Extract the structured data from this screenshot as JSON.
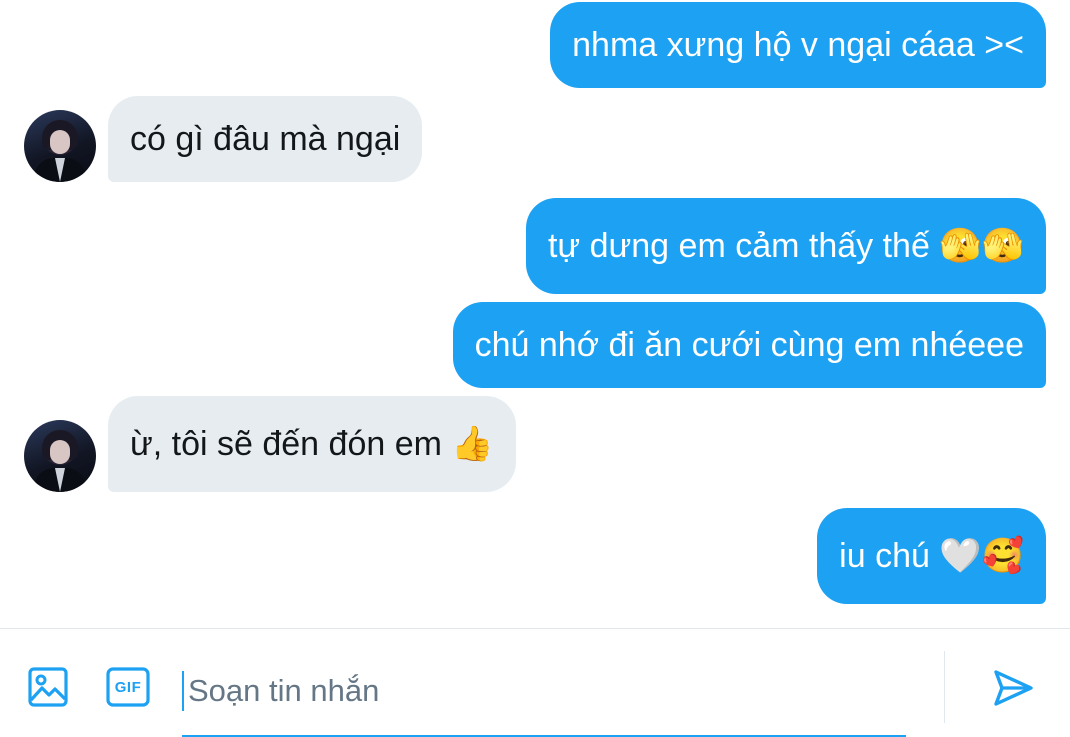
{
  "conversation": {
    "messages": [
      {
        "direction": "outgoing",
        "text": "nhma xưng hộ v ngại cáaa ><"
      },
      {
        "direction": "incoming",
        "text": "có gì đâu mà ngại"
      },
      {
        "direction": "outgoing",
        "text": "tự dưng em cảm thấy thế 🫣🫣"
      },
      {
        "direction": "outgoing",
        "text": "chú nhớ đi ăn cưới cùng em nhéeee"
      },
      {
        "direction": "incoming",
        "text": "ừ, tôi sẽ đến đón em 👍"
      },
      {
        "direction": "outgoing",
        "text": "iu chú 🤍🥰"
      }
    ]
  },
  "composer": {
    "placeholder": "Soạn tin nhắn",
    "value": "",
    "gif_label": "GIF",
    "icons": [
      "image-icon",
      "gif-icon",
      "send-icon"
    ]
  },
  "colors": {
    "outgoing_bubble": "#1da1f2",
    "incoming_bubble": "#e6ecf0",
    "accent": "#1da1f2",
    "text_dark": "#14171a",
    "placeholder": "#657786"
  }
}
